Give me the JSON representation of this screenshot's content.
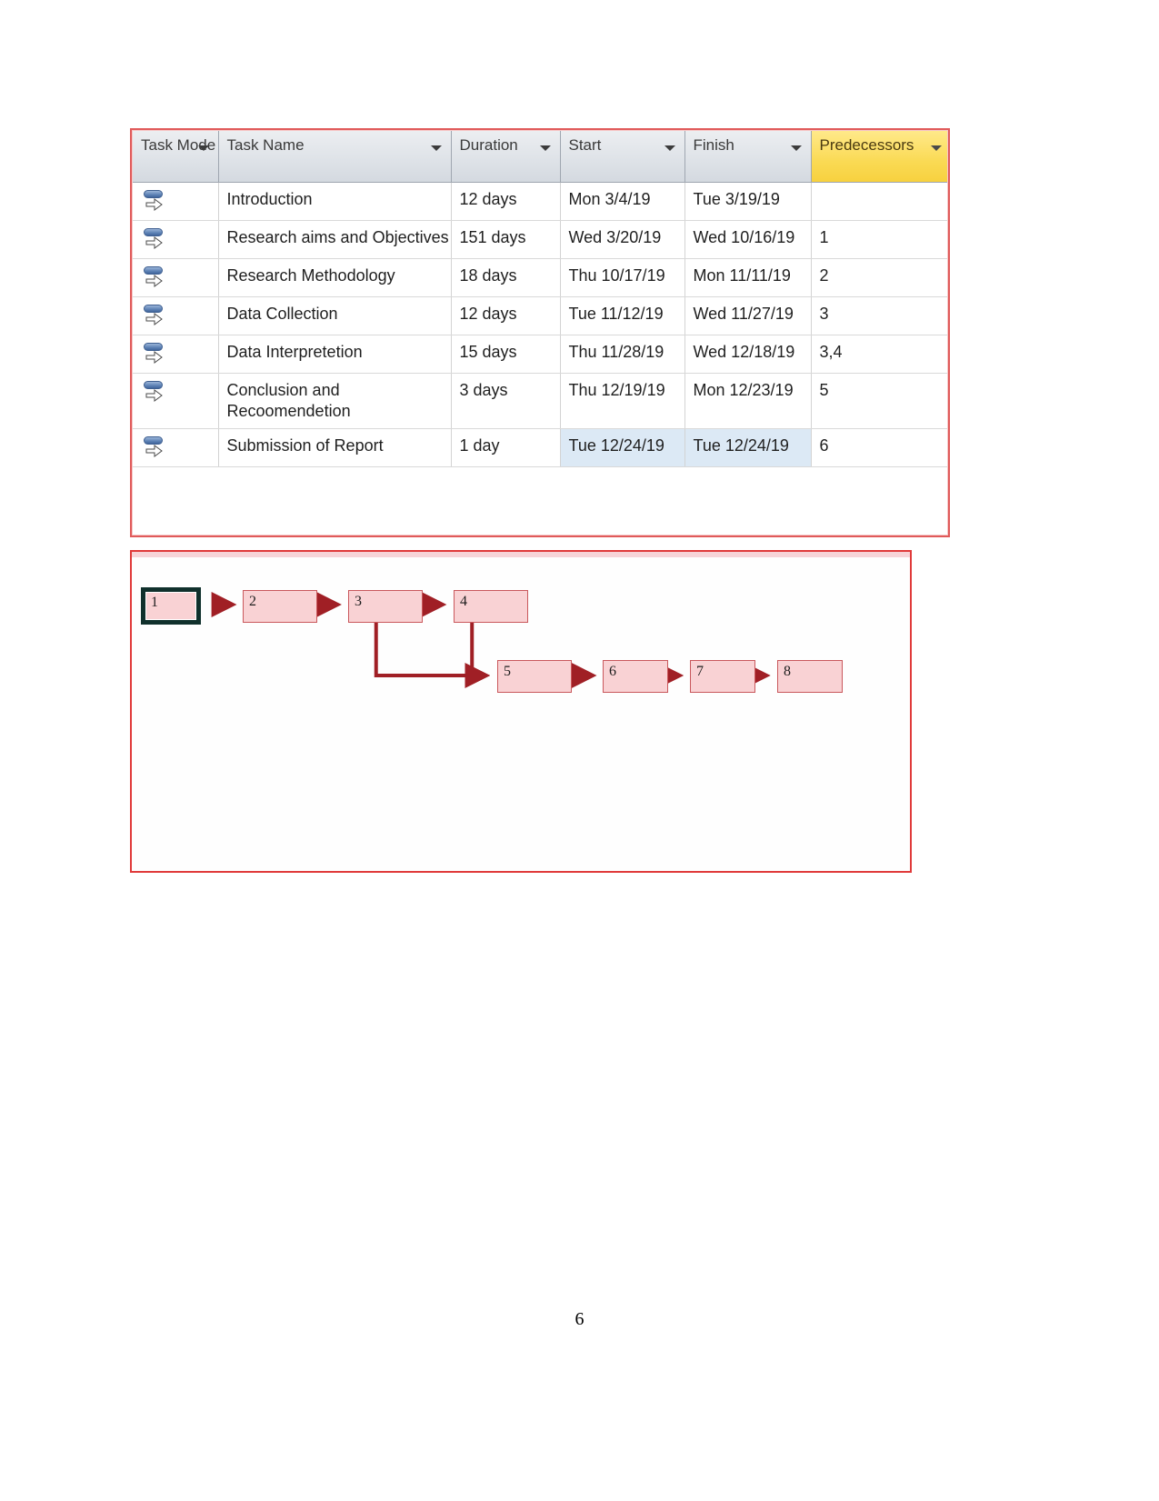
{
  "document": {
    "page_number": "6"
  },
  "project_table": {
    "columns": [
      {
        "key": "task_mode",
        "label": "Task Mode",
        "has_filter": true,
        "highlighted": false
      },
      {
        "key": "task_name",
        "label": "Task Name",
        "has_filter": true,
        "highlighted": false
      },
      {
        "key": "duration",
        "label": "Duration",
        "has_filter": true,
        "highlighted": false
      },
      {
        "key": "start",
        "label": "Start",
        "has_filter": true,
        "highlighted": false
      },
      {
        "key": "finish",
        "label": "Finish",
        "has_filter": true,
        "highlighted": false
      },
      {
        "key": "predecessors",
        "label": "Predecessors",
        "has_filter": true,
        "highlighted": true
      }
    ],
    "header_highlight_color": "#fada54",
    "selection_color": "#dce9f5",
    "rows": [
      {
        "task_mode_icon": "auto-scheduled-icon",
        "task_name": "Introduction",
        "duration": "12 days",
        "start": "Mon 3/4/19",
        "finish": "Tue 3/19/19",
        "predecessors": ""
      },
      {
        "task_mode_icon": "auto-scheduled-icon",
        "task_name": "Research aims and Objectives",
        "duration": "151 days",
        "start": "Wed 3/20/19",
        "finish": "Wed 10/16/19",
        "predecessors": "1"
      },
      {
        "task_mode_icon": "auto-scheduled-icon",
        "task_name": "Research Methodology",
        "duration": "18 days",
        "start": "Thu 10/17/19",
        "finish": "Mon 11/11/19",
        "predecessors": "2"
      },
      {
        "task_mode_icon": "auto-scheduled-icon",
        "task_name": "Data Collection",
        "duration": "12 days",
        "start": "Tue 11/12/19",
        "finish": "Wed 11/27/19",
        "predecessors": "3"
      },
      {
        "task_mode_icon": "auto-scheduled-icon",
        "task_name": "Data Interpretetion",
        "duration": "15 days",
        "start": "Thu 11/28/19",
        "finish": "Wed 12/18/19",
        "predecessors": "3,4"
      },
      {
        "task_mode_icon": "auto-scheduled-icon",
        "task_name": "Conclusion and Recoomendetion",
        "duration": "3 days",
        "start": "Thu 12/19/19",
        "finish": "Mon 12/23/19",
        "predecessors": "5"
      },
      {
        "task_mode_icon": "auto-scheduled-icon",
        "task_name": "Submission of Report",
        "duration": "1 day",
        "start": "Tue 12/24/19",
        "finish": "Tue 12/24/19",
        "predecessors": "6",
        "selected": true
      }
    ]
  },
  "network_diagram": {
    "node_fill_color": "#f9d2d4",
    "node_border_color": "#c9585c",
    "link_color": "#a01f25",
    "selected_border_color": "#10302c",
    "nodes": [
      {
        "id": "1",
        "label": "1",
        "selected": true
      },
      {
        "id": "2",
        "label": "2",
        "selected": false
      },
      {
        "id": "3",
        "label": "3",
        "selected": false
      },
      {
        "id": "4",
        "label": "4",
        "selected": false
      },
      {
        "id": "5",
        "label": "5",
        "selected": false
      },
      {
        "id": "6",
        "label": "6",
        "selected": false
      },
      {
        "id": "7",
        "label": "7",
        "selected": false
      },
      {
        "id": "8",
        "label": "8",
        "selected": false
      }
    ],
    "links": [
      {
        "from": "1",
        "to": "2"
      },
      {
        "from": "2",
        "to": "3"
      },
      {
        "from": "3",
        "to": "4"
      },
      {
        "from": "3",
        "to": "5"
      },
      {
        "from": "4",
        "to": "5"
      },
      {
        "from": "5",
        "to": "6"
      },
      {
        "from": "6",
        "to": "7"
      },
      {
        "from": "7",
        "to": "8"
      }
    ]
  }
}
